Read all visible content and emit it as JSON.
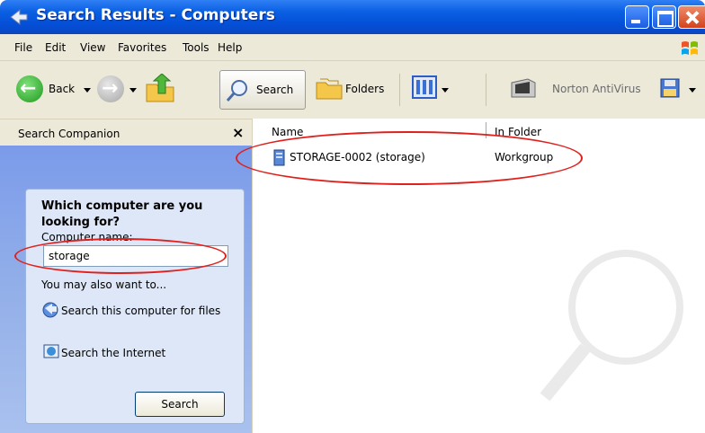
{
  "window": {
    "title": "Search Results - Computers"
  },
  "menu": [
    "File",
    "Edit",
    "View",
    "Favorites",
    "Tools",
    "Help"
  ],
  "toolbar": {
    "back_label": "Back",
    "search_label": "Search",
    "folders_label": "Folders",
    "norton_label": "Norton AntiVirus"
  },
  "search_companion": {
    "title": "Search Companion",
    "close_glyph": "×",
    "question": "Which computer are you looking for?",
    "computer_name_label": "Computer name:",
    "computer_name_value": "storage",
    "also_label": "You may also want to...",
    "search_computer_link": "Search this computer for files",
    "search_internet_link": "Search the Internet",
    "search_button": "Search"
  },
  "results": {
    "columns": [
      "Name",
      "In Folder"
    ],
    "rows": [
      {
        "name": "STORAGE-0002 (storage)",
        "folder": "Workgroup"
      }
    ]
  },
  "colors": {
    "titlebar": "#0a5fe2",
    "chrome": "#ece9d8",
    "pane": "#93afe9",
    "annotation": "#e0201c"
  }
}
